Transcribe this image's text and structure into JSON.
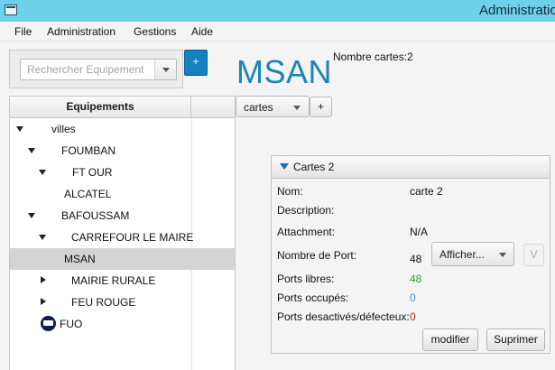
{
  "window": {
    "title": "Administratio"
  },
  "menu": [
    "File",
    "Administration",
    "Gestions",
    "Aide"
  ],
  "search": {
    "placeholder": "Rechercher Equipement",
    "value": ""
  },
  "add_equipment_label": "+",
  "header": {
    "equipment_name": "MSAN",
    "card_count": "Nombre cartes:2"
  },
  "tree": {
    "column_header": "Equipements",
    "items": [
      {
        "label": "villes",
        "expand": "expanded"
      },
      {
        "label": "FOUMBAN",
        "expand": "expanded"
      },
      {
        "label": "FT OUR",
        "expand": "expanded"
      },
      {
        "label": "ALCATEL",
        "expand": "none"
      },
      {
        "label": "BAFOUSSAM",
        "expand": "expanded"
      },
      {
        "label": "CARREFOUR LE MAIRE",
        "expand": "expanded"
      },
      {
        "label": "MSAN",
        "expand": "none",
        "selected": true
      },
      {
        "label": "MAIRIE RURALE",
        "expand": "collapsed"
      },
      {
        "label": "FEU ROUGE",
        "expand": "collapsed"
      },
      {
        "label": "FUO",
        "expand": "none",
        "icon": "building-icon"
      }
    ]
  },
  "cards_selector": {
    "selected": "cartes",
    "add_label": "+"
  },
  "card_pane": {
    "title": "Cartes 2",
    "fields": {
      "nom": {
        "label": "Nom:",
        "value": "carte 2"
      },
      "description": {
        "label": "Description:",
        "value": ""
      },
      "attachment": {
        "label": "Attachment:",
        "value": "N/A"
      },
      "nombre_port": {
        "label": "Nombre de Port:",
        "value": "48"
      },
      "ports_libres": {
        "label": "Ports libres:",
        "value": "48",
        "color": "#26a82e"
      },
      "ports_occupes": {
        "label": "Ports occupés:",
        "value": "0",
        "color": "#1e9ad6"
      },
      "ports_desactives": {
        "label": "Ports desactivés/défecteux:",
        "value": "0",
        "color": "#d2231c"
      }
    },
    "show_combo": "Afficher...",
    "v_button": "V",
    "modify_button": "modifier",
    "delete_button": "Suprimer"
  },
  "colors": {
    "titlebar": "#6fd0ec",
    "accent": "#1380bf",
    "title_text": "#1b84b8"
  }
}
